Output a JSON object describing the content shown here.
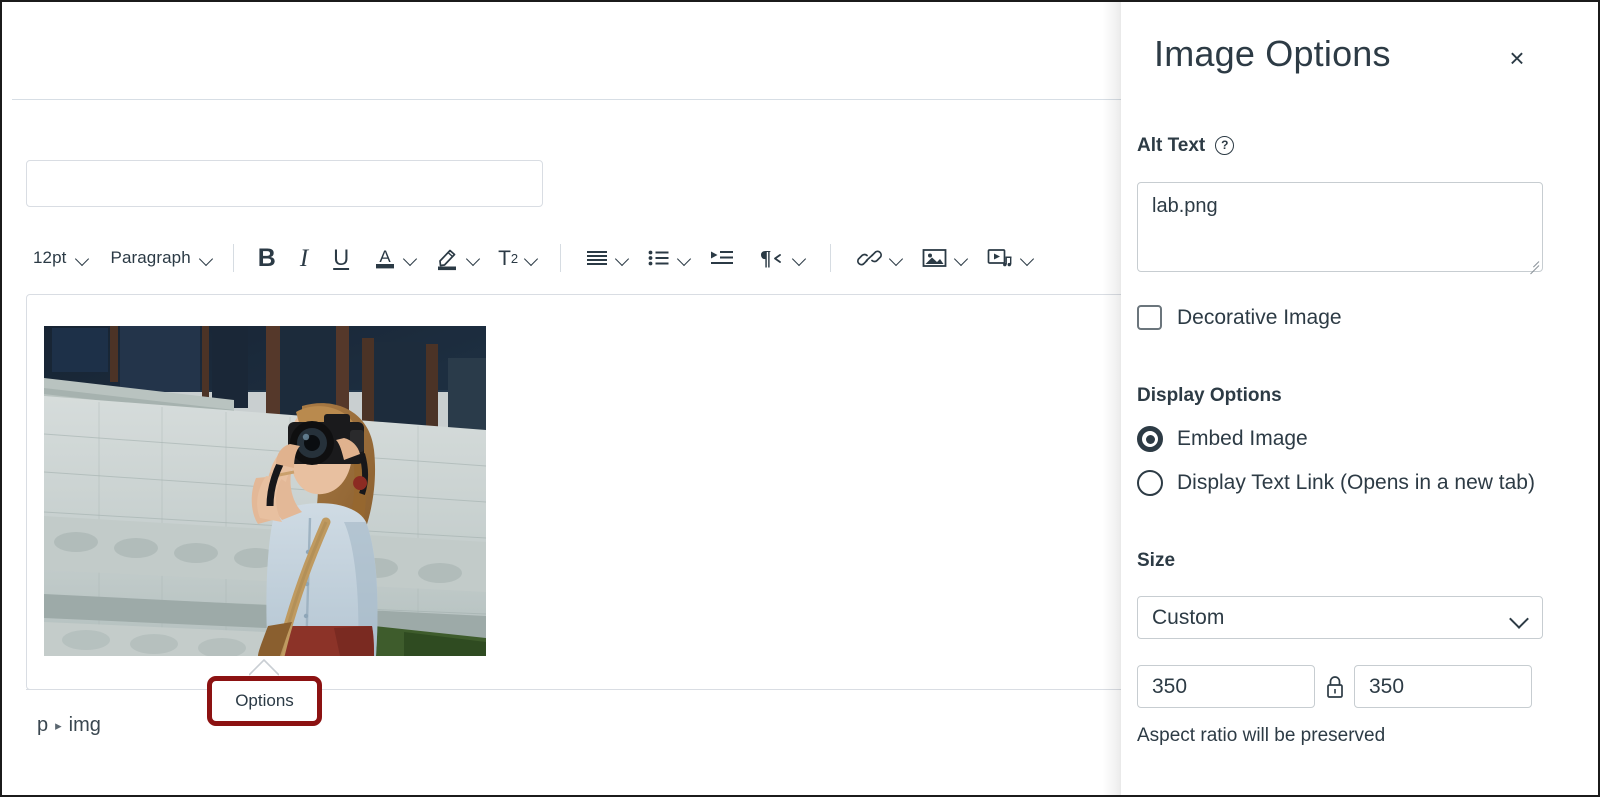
{
  "editor": {
    "title_input_value": "",
    "title_input_placeholder": "",
    "toolbar": {
      "font_size": "12pt",
      "block_format": "Paragraph",
      "bold_label": "B",
      "italic_label": "I",
      "underline_label": "U",
      "text_color_label": "A",
      "superscript_label": "T",
      "superscript_exponent": "2"
    },
    "statusbar": {
      "crumb_parent": "p",
      "crumb_arrow": "▸",
      "crumb_child": "img"
    },
    "options_popover": {
      "label": "Options",
      "highlight_color": "#8c1212"
    },
    "image": {
      "alt": "lab.png"
    }
  },
  "tray": {
    "title": "Image Options",
    "close_label": "×",
    "alt_text": {
      "label": "Alt Text",
      "help_glyph": "?",
      "value": "lab.png",
      "placeholder": ""
    },
    "decorative": {
      "label": "Decorative Image",
      "checked": false
    },
    "display_options": {
      "label": "Display Options",
      "items": [
        {
          "label": "Embed Image",
          "selected": true
        },
        {
          "label": "Display Text Link (Opens in a new tab)",
          "selected": false
        }
      ]
    },
    "size": {
      "label": "Size",
      "selected": "Custom",
      "width_value": "350",
      "height_value": "350",
      "lock_state": "locked",
      "aspect_note": "Aspect ratio will be preserved"
    }
  },
  "colors": {
    "text_primary": "#2d3b45",
    "border": "#c7cdd1",
    "annotation_red": "#8c1212",
    "panel_bg": "#ffffff"
  }
}
